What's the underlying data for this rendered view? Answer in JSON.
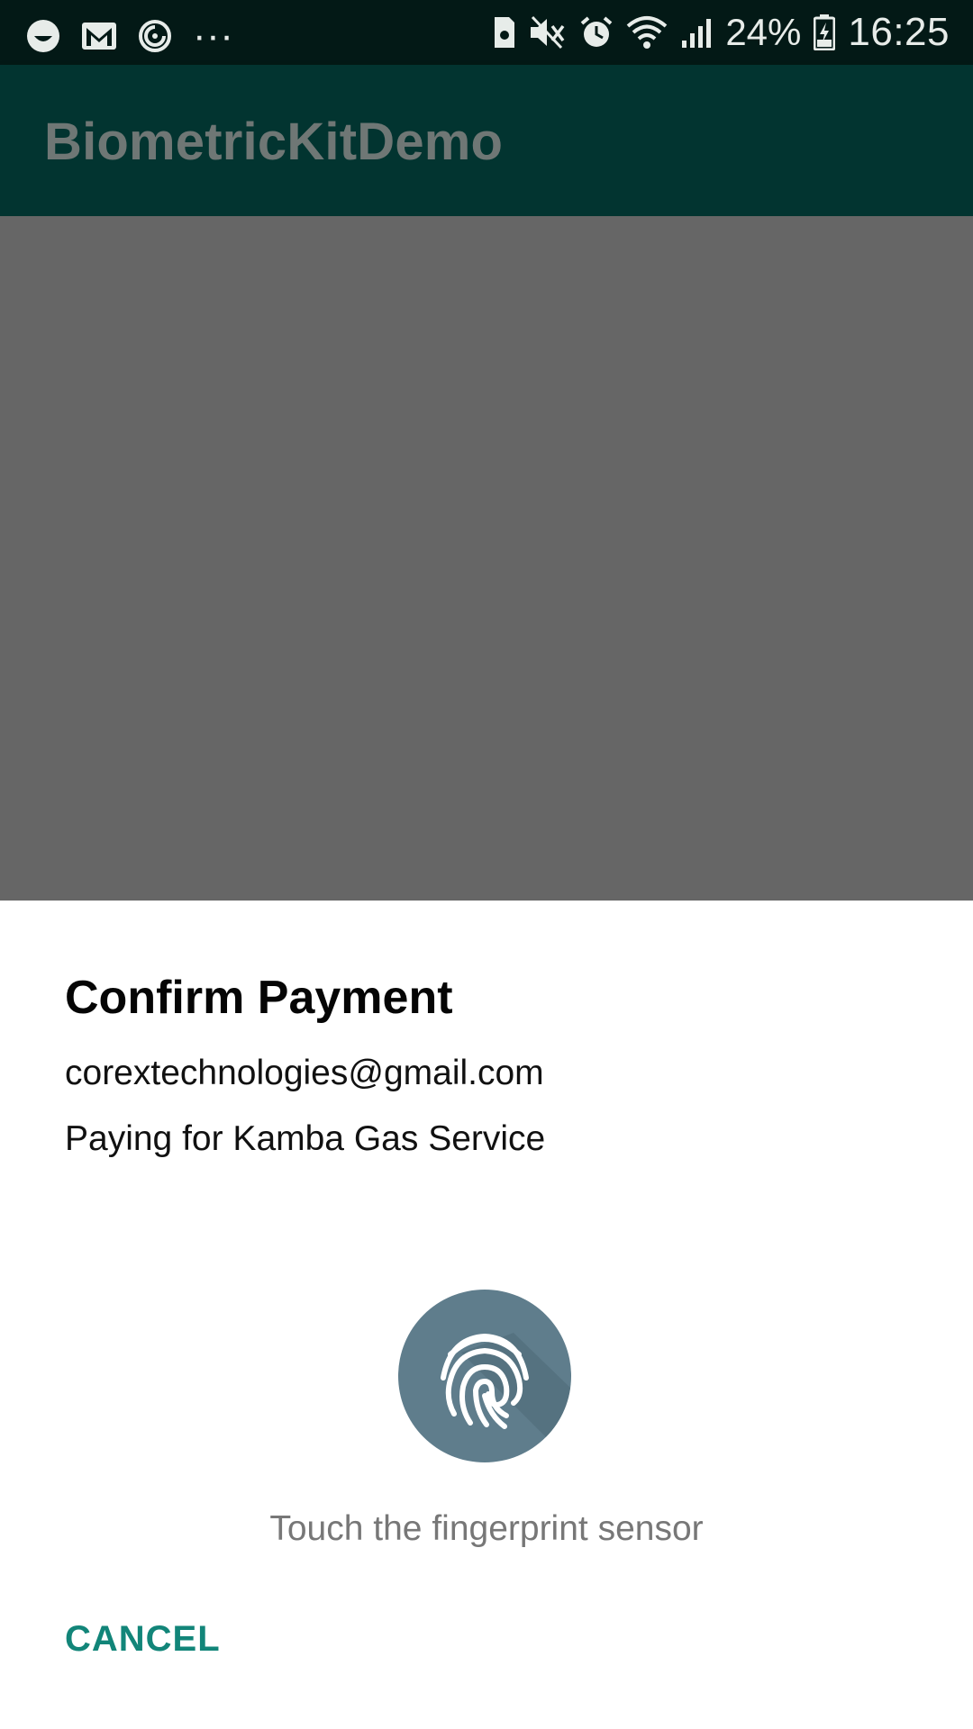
{
  "status_bar": {
    "battery_percent": "24%",
    "time": "16:25",
    "overflow_indicator": "···",
    "icons": [
      "smiley-notification-icon",
      "gmail-icon",
      "sync-icon",
      "more-icon",
      "sim-card-icon",
      "mute-icon",
      "alarm-icon",
      "wifi-icon",
      "signal-icon",
      "battery-icon"
    ]
  },
  "app_bar": {
    "title": "BiometricKitDemo",
    "background_color": "#023430"
  },
  "dialog": {
    "title": "Confirm Payment",
    "subtitle": "corextechnologies@gmail.com",
    "description": "Paying for Kamba Gas Service",
    "status_message": "Touch the fingerprint sensor",
    "fingerprint_icon": "fingerprint-icon",
    "fingerprint_color": "#5f7d8c",
    "cancel_label": "CANCEL",
    "accent_color": "#128579"
  }
}
